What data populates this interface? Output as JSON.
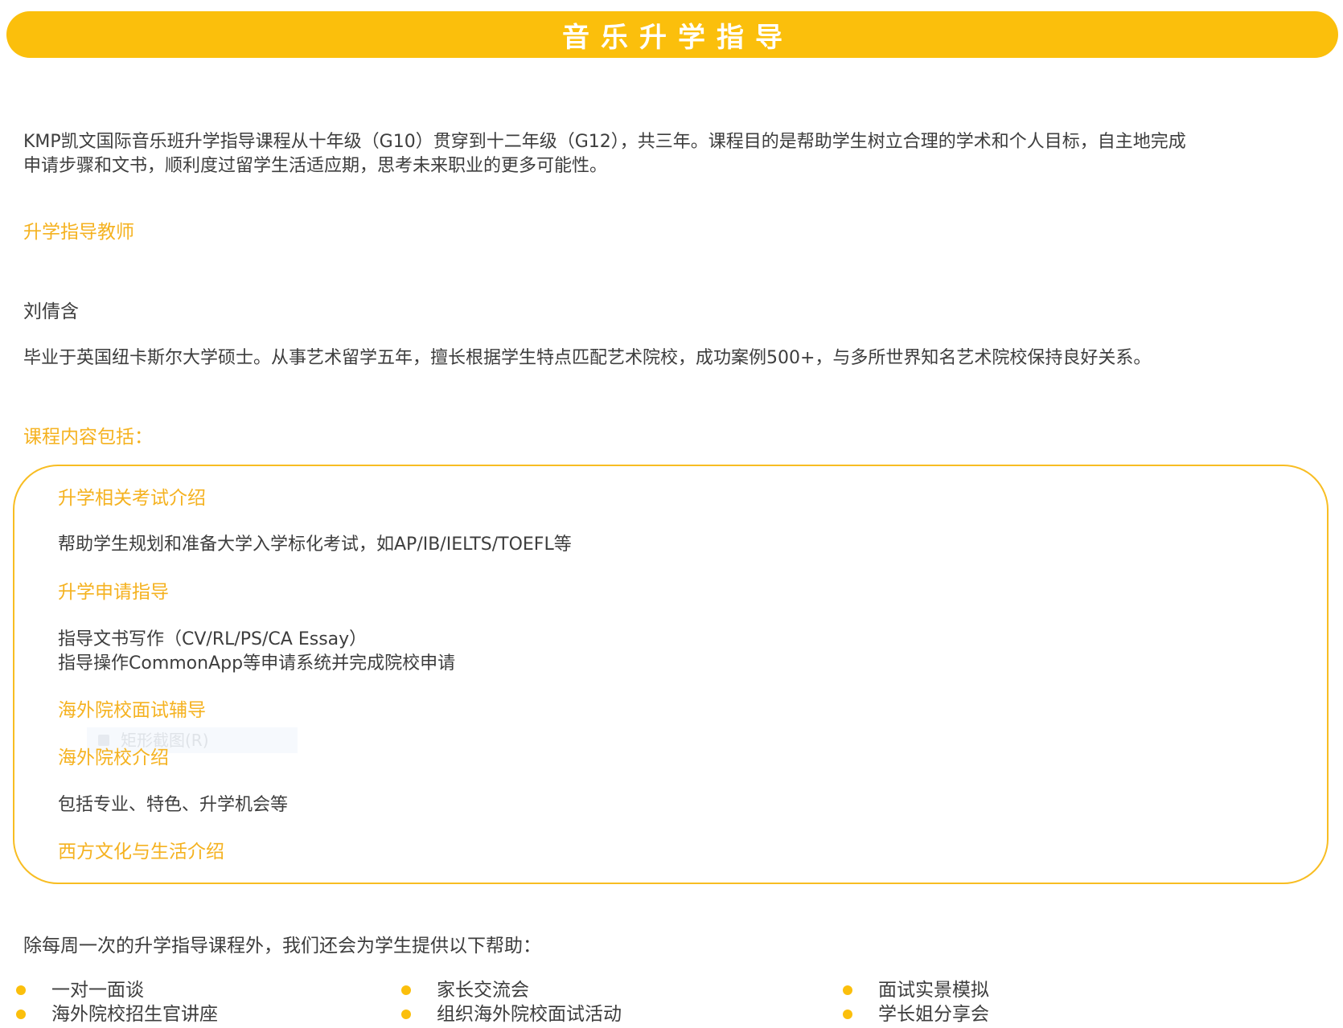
{
  "header": {
    "title": "音乐升学指导"
  },
  "intro": {
    "line1": "KMP凯文国际音乐班升学指导课程从十年级（G10）贯穿到十二年级（G12），共三年。课程目的是帮助学生树立合理的学术和个人目标，自主地完成",
    "line2": "申请步骤和文书，顺利度过留学生活适应期，思考未来职业的更多可能性。"
  },
  "teacher": {
    "heading": "升学指导教师",
    "name": "刘倩含",
    "bio": "毕业于英国纽卡斯尔大学硕士。从事艺术留学五年，擅长根据学生特点匹配艺术院校，成功案例500+，与多所世界知名艺术院校保持良好关系。"
  },
  "courses": {
    "heading": "课程内容包括：",
    "items": [
      {
        "title": "升学相关考试介绍",
        "desc": [
          "帮助学生规划和准备大学入学标化考试，如AP/IB/IELTS/TOEFL等"
        ]
      },
      {
        "title": "升学申请指导",
        "desc": [
          "指导文书写作（CV/RL/PS/CA Essay）",
          "指导操作CommonApp等申请系统并完成院校申请"
        ]
      },
      {
        "title": "海外院校面试辅导",
        "desc": []
      },
      {
        "title": "海外院校介绍",
        "desc": [
          "包括专业、特色、升学机会等"
        ]
      },
      {
        "title": "西方文化与生活介绍",
        "desc": []
      }
    ],
    "ghost_label": "矩形截图(R)"
  },
  "extra": {
    "intro": "除每周一次的升学指导课程外，我们还会为学生提供以下帮助：",
    "columns": [
      [
        "一对一面谈",
        "海外院校招生官讲座"
      ],
      [
        "家长交流会",
        "组织海外院校面试活动"
      ],
      [
        "面试实景模拟",
        "学长姐分享会"
      ]
    ]
  },
  "colors": {
    "accent": "#fbbf0c",
    "heading": "#f5b220",
    "text": "#3d3d3d"
  }
}
